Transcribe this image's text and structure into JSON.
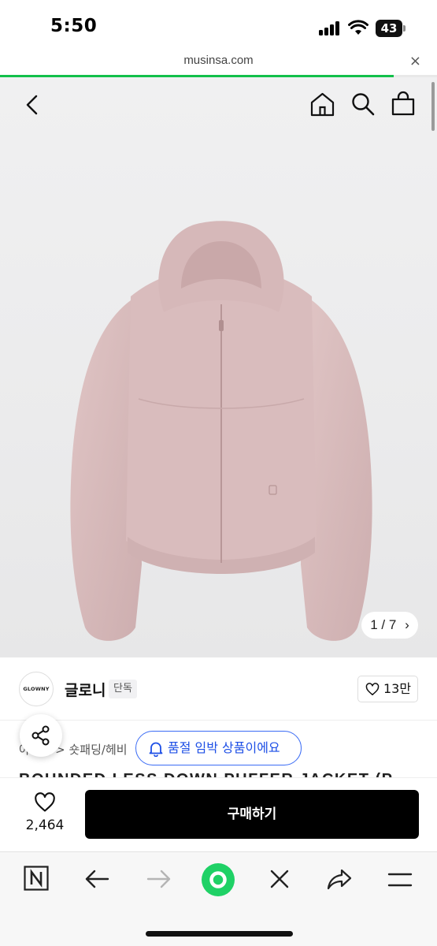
{
  "status_bar": {
    "time": "5:50",
    "battery": "43"
  },
  "browser": {
    "url": "musinsa.com",
    "close_glyph": "×",
    "load_progress": 0.9,
    "accent_color": "#12c04a"
  },
  "header_icons": [
    "back-icon",
    "home-icon",
    "search-icon",
    "cart-icon"
  ],
  "gallery": {
    "current": "1",
    "total": "7",
    "pager_text": "1 / 7",
    "next_glyph": "›",
    "product_color": "#d9bcbd"
  },
  "brand": {
    "logo_text": "GLOWNY",
    "name": "글로니",
    "badge": "단독",
    "likes": "13만"
  },
  "product": {
    "breadcrumb": "아우터 > 숏패딩/헤비",
    "title_peek": "BOUNDED LESS DOWN PUFFER JACKET (P"
  },
  "toast": {
    "text": "품절 임박 상품이에요",
    "color": "#1d4fe6"
  },
  "purchase": {
    "wish_count": "2,464",
    "buy_label": "구매하기"
  },
  "toolbar_icons": [
    "naver-n-icon",
    "back-arrow-icon",
    "forward-arrow-icon",
    "green-dot-icon",
    "close-x-icon",
    "share-arrow-icon",
    "menu-icon"
  ]
}
